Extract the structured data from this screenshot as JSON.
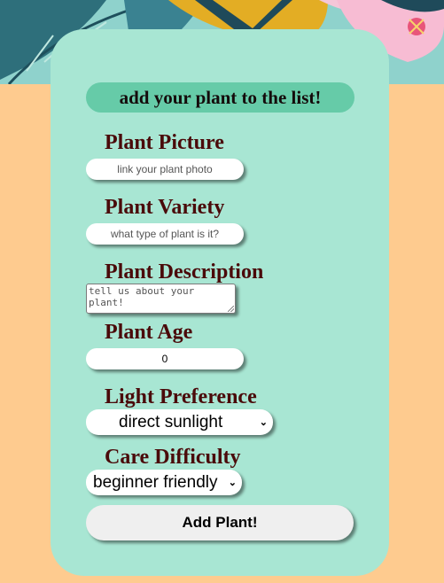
{
  "form": {
    "title": "add your plant to the list!",
    "picture": {
      "label": "Plant Picture",
      "placeholder": "link your plant photo"
    },
    "variety": {
      "label": "Plant Variety",
      "placeholder": "what type of plant is it?"
    },
    "description": {
      "label": "Plant Description",
      "placeholder": "tell us about your plant!"
    },
    "age": {
      "label": "Plant Age",
      "value": "0"
    },
    "light": {
      "label": "Light Preference",
      "selected": "direct sunlight"
    },
    "difficulty": {
      "label": "Care Difficulty",
      "selected": "beginner friendly"
    },
    "submit_label": "Add Plant!"
  },
  "colors": {
    "page_background": "#fecb8f",
    "card": "#a8e6d3",
    "header_pill": "#66cba8",
    "label_text": "#4a0a0a",
    "button": "#efefef"
  },
  "icons": {
    "select_arrow": "chevron-down-icon",
    "banner": "tropical-leaves-decoration",
    "resize": "resize-grip-icon"
  }
}
